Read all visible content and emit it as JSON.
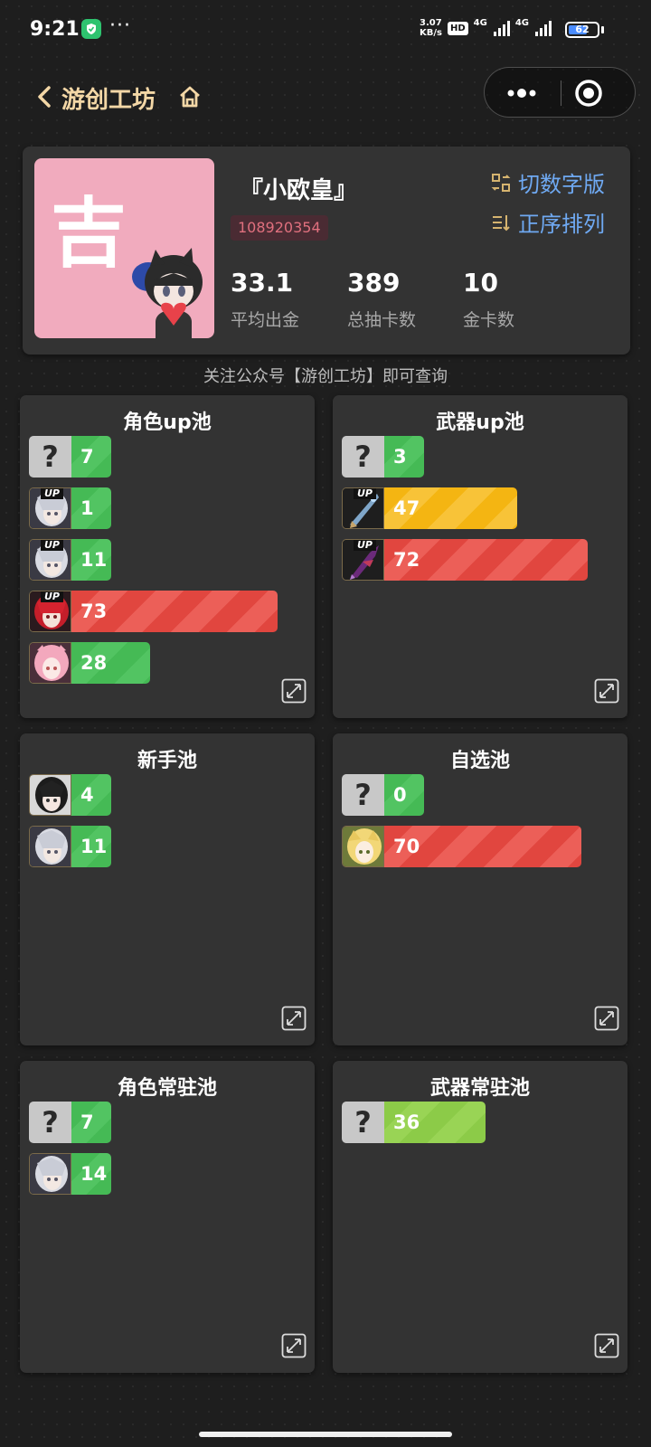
{
  "status_bar": {
    "time": "9:21",
    "more": "···",
    "net_speed_value": "3.07",
    "net_speed_unit": "KB/s",
    "hd": "HD",
    "signal1": "4G",
    "signal2": "4G",
    "battery": "62"
  },
  "nav": {
    "title": "游创工坊"
  },
  "profile": {
    "avatar_char": "吉",
    "nickname": "『小欧皇』",
    "uid": "108920354",
    "switch_label": "切数字版",
    "sort_label": "正序排列",
    "stats": [
      {
        "value": "33.1",
        "label": "平均出金"
      },
      {
        "value": "389",
        "label": "总抽卡数"
      },
      {
        "value": "10",
        "label": "金卡数"
      }
    ]
  },
  "hint": "关注公众号【游创工坊】即可查询",
  "pools": [
    {
      "title": "角色up池",
      "items": [
        {
          "icon": "unknown",
          "value": 7,
          "color": "green"
        },
        {
          "icon": "character-silver-hair",
          "up": true,
          "value": 1,
          "color": "green"
        },
        {
          "icon": "character-silver-hair",
          "up": true,
          "value": 11,
          "color": "green"
        },
        {
          "icon": "character-red-hair",
          "up": true,
          "value": 73,
          "color": "red"
        },
        {
          "icon": "character-pink-hair",
          "value": 28,
          "color": "green"
        }
      ]
    },
    {
      "title": "武器up池",
      "items": [
        {
          "icon": "unknown",
          "value": 3,
          "color": "green"
        },
        {
          "icon": "weapon-blue",
          "up": true,
          "value": 47,
          "color": "yellow"
        },
        {
          "icon": "weapon-purple",
          "up": true,
          "value": 72,
          "color": "red"
        }
      ]
    },
    {
      "title": "新手池",
      "items": [
        {
          "icon": "character-black-hair",
          "value": 4,
          "color": "green"
        },
        {
          "icon": "character-silver-hair",
          "value": 11,
          "color": "green"
        }
      ]
    },
    {
      "title": "自选池",
      "items": [
        {
          "icon": "unknown",
          "value": 0,
          "color": "green"
        },
        {
          "icon": "character-blonde-hair",
          "value": 70,
          "color": "red"
        }
      ]
    },
    {
      "title": "角色常驻池",
      "items": [
        {
          "icon": "unknown",
          "value": 7,
          "color": "green"
        },
        {
          "icon": "character-silver-hair",
          "value": 14,
          "color": "green"
        }
      ]
    },
    {
      "title": "武器常驻池",
      "items": [
        {
          "icon": "unknown",
          "value": 36,
          "color": "lime"
        }
      ]
    }
  ],
  "colors": {
    "accent_gold": "#f3d7a6",
    "link_blue": "#6fa9f2",
    "uid_text": "#e0707e",
    "bar_green": "#45ba55",
    "bar_yellow": "#f4b512",
    "bar_red": "#e1463f",
    "bar_lime": "#8ccb48"
  }
}
